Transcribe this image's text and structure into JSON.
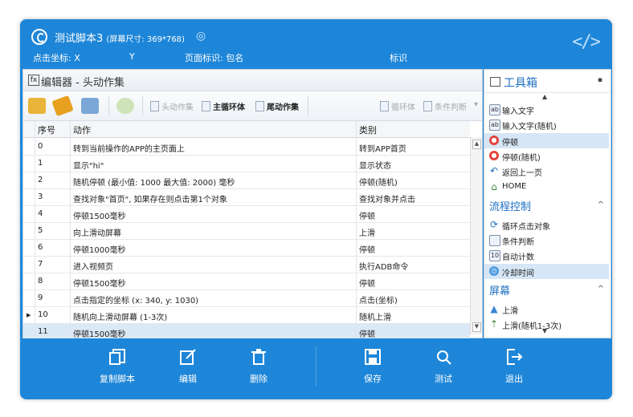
{
  "header": {
    "title": "测试脚本3",
    "screen_size": "(屏幕尺寸: 369*768)",
    "coord_label": "点击坐标: X",
    "coord_y": "Y",
    "page_label": "页面标识: 包名",
    "mark_label": "标识"
  },
  "editor": {
    "title": "编辑器 - 头动作集",
    "toolbar": {
      "head_actions": "头动作集",
      "main_loop": "主循环体",
      "tail_actions": "尾动作集",
      "loop": "循环体",
      "condition": "条件判断"
    },
    "columns": {
      "index": "序号",
      "action": "动作",
      "category": "类别"
    },
    "rows": [
      {
        "index": "0",
        "action": "转到当前操作的APP的主页面上",
        "category": "转到APP首页"
      },
      {
        "index": "1",
        "action": "显示\"hi\"",
        "category": "显示状态"
      },
      {
        "index": "2",
        "action": "随机停顿 (最小值: 1000 最大值: 2000) 毫秒",
        "category": "停顿(随机)"
      },
      {
        "index": "3",
        "action": "查找对象\"首页\", 如果存在则点击第1个对象",
        "category": "查找对象并点击"
      },
      {
        "index": "4",
        "action": "停顿1500毫秒",
        "category": "停顿"
      },
      {
        "index": "5",
        "action": "向上滑动屏幕",
        "category": "上滑"
      },
      {
        "index": "6",
        "action": "停顿1000毫秒",
        "category": "停顿"
      },
      {
        "index": "7",
        "action": "进入视频页",
        "category": "执行ADB命令"
      },
      {
        "index": "8",
        "action": "停顿1500毫秒",
        "category": "停顿"
      },
      {
        "index": "9",
        "action": "点击指定的坐标 (x: 340, y: 1030)",
        "category": "点击(坐标)"
      },
      {
        "index": "10",
        "action": "随机向上滑动屏幕 (1-3次)",
        "category": "随机上滑"
      },
      {
        "index": "11",
        "action": "停顿1500毫秒",
        "category": "停顿"
      }
    ]
  },
  "toolbox": {
    "title": "工具箱",
    "items": [
      {
        "label": "输入文字",
        "icon": "text-input-icon"
      },
      {
        "label": "输入文字(随机)",
        "icon": "text-input-icon"
      },
      {
        "label": "停顿",
        "icon": "stop-icon"
      },
      {
        "label": "停顿(随机)",
        "icon": "stop-icon"
      },
      {
        "label": "返回上一页",
        "icon": "back-icon"
      },
      {
        "label": "HOME",
        "icon": "home-icon"
      }
    ],
    "flow_group": "流程控制",
    "flow_items": [
      {
        "label": "循环点击对象",
        "icon": "loop-icon"
      },
      {
        "label": "条件判断",
        "icon": "condition-icon"
      },
      {
        "label": "自动计数",
        "icon": "counter-icon"
      },
      {
        "label": "冷却时间",
        "icon": "cooldown-icon"
      }
    ],
    "screen_group": "屏幕",
    "screen_items": [
      {
        "label": "上滑",
        "icon": "up-arrow-icon"
      },
      {
        "label": "上滑(随机1-3次)",
        "icon": "random-up-icon"
      }
    ]
  },
  "footer": {
    "copy": "复制脚本",
    "edit": "编辑",
    "delete": "删除",
    "save": "保存",
    "test": "测试",
    "exit": "退出"
  },
  "colors": {
    "primary": "#1e86d8",
    "selected_row": "#dbe8f6",
    "group_text": "#1e6fc0"
  }
}
